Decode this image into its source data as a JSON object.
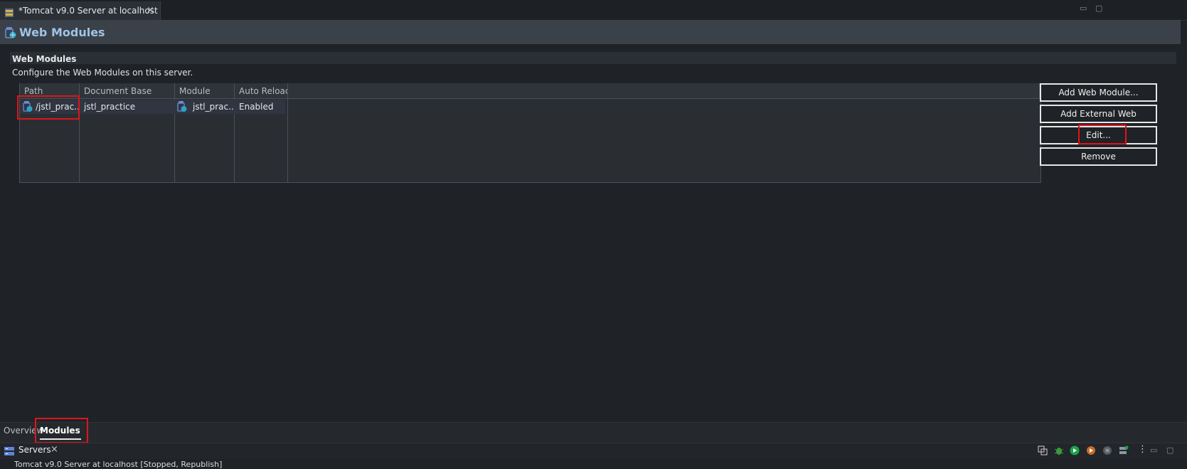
{
  "editor": {
    "tab_title": "*Tomcat v9.0 Server at localhost",
    "tab_close": "×",
    "minimize": "▭",
    "maximize": "▢"
  },
  "header": {
    "title": "Web Modules"
  },
  "section": {
    "title": "Web Modules",
    "description": "Configure the Web Modules on this server."
  },
  "table": {
    "columns": [
      "Path",
      "Document Base",
      "Module",
      "Auto Reloac"
    ],
    "rows": [
      {
        "path": "/jstl_prac...",
        "document_base": "jstl_practice",
        "module": "jstl_prac...",
        "auto_reload": "Enabled"
      }
    ]
  },
  "buttons": {
    "add_web_module": "Add Web Module...",
    "add_external": "Add External Web Module...",
    "edit": "Edit...",
    "remove": "Remove"
  },
  "bottom_tabs": {
    "overview": "Overview",
    "modules": "Modules"
  },
  "servers_view": {
    "title": "Servers",
    "close": "×",
    "row_text": "Tomcat v9.0 Server at localhost  [Stopped, Republish]",
    "more": "⋮"
  },
  "colors": {
    "highlight": "#e0141b",
    "header_title": "#9fc4e6",
    "start_green": "#1aa34a"
  }
}
